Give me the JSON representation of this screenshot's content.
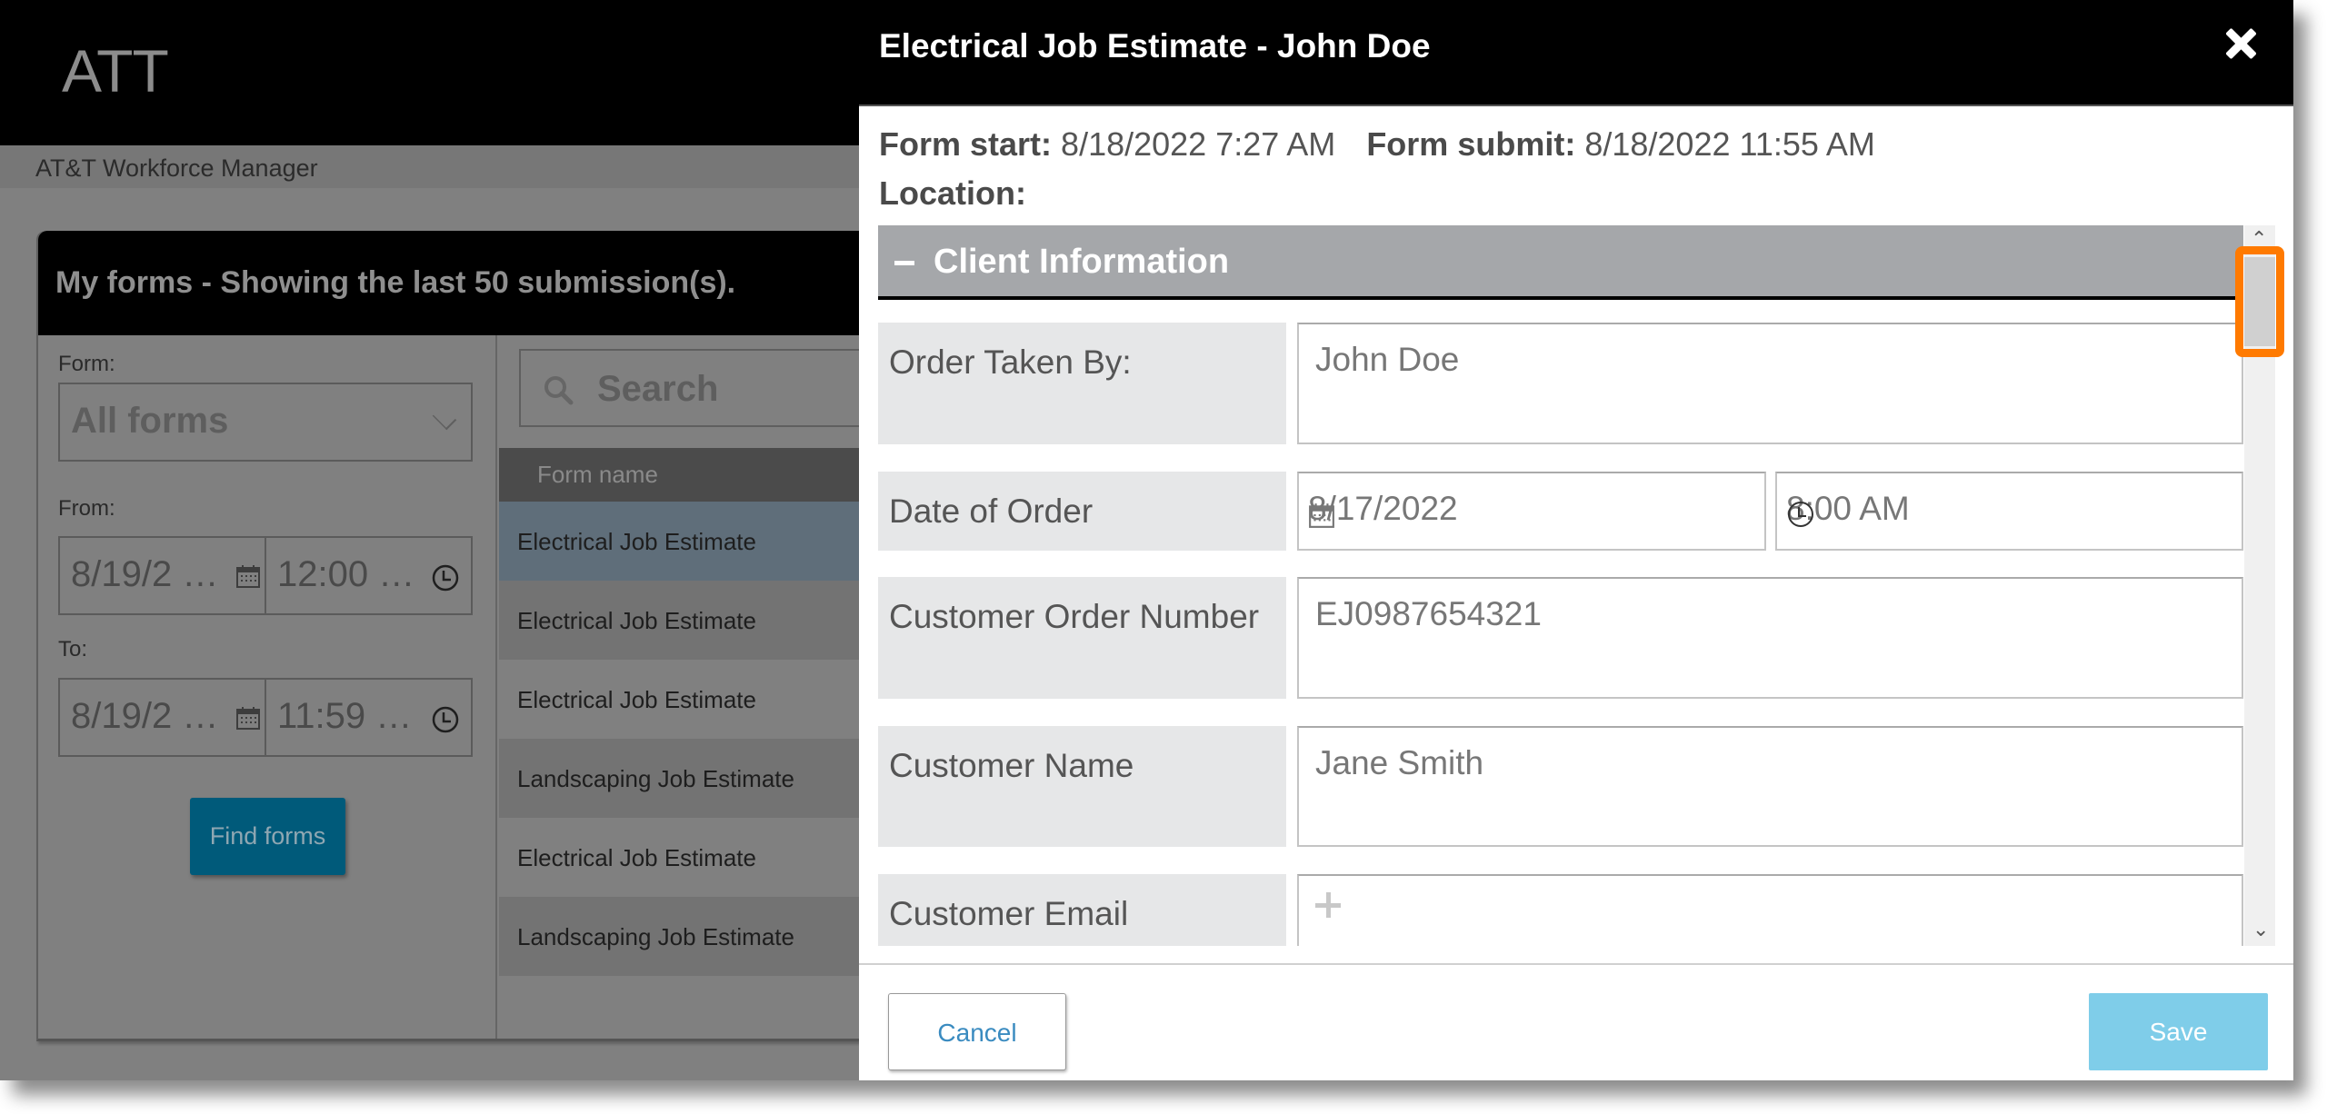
{
  "app": {
    "title": "ATT",
    "breadcrumb": "AT&T Workforce Manager"
  },
  "panel": {
    "title": "My forms - Showing the last 50 submission(s).",
    "filters": {
      "form_label": "Form:",
      "form_value": "All forms",
      "from_label": "From:",
      "from_date": "8/19/2 …",
      "from_time": "12:00 …",
      "to_label": "To:",
      "to_date": "8/19/2 …",
      "to_time": "11:59 …",
      "find_button": "Find forms"
    },
    "results": {
      "search_placeholder": "Search",
      "column_header": "Form name",
      "rows": [
        {
          "name": "Electrical Job Estimate",
          "selected": true
        },
        {
          "name": "Electrical Job Estimate",
          "selected": false
        },
        {
          "name": "Electrical Job Estimate",
          "selected": false
        },
        {
          "name": "Landscaping Job Estimate",
          "selected": false
        },
        {
          "name": "Electrical Job Estimate",
          "selected": false
        },
        {
          "name": "Landscaping Job Estimate",
          "selected": false
        }
      ]
    }
  },
  "modal": {
    "title": "Electrical Job Estimate - John Doe",
    "close_icon": "close-icon",
    "form_start_label": "Form start:",
    "form_start_value": "8/18/2022 7:27 AM",
    "form_submit_label": "Form submit:",
    "form_submit_value": "8/18/2022 11:55 AM",
    "location_label": "Location:",
    "section": {
      "toggle": "−",
      "title": "Client Information",
      "expanded": true
    },
    "fields": [
      {
        "label": "Order Taken By:",
        "value": "John Doe"
      },
      {
        "label": "Date of Order",
        "date": "8/17/2022",
        "time": "8:00 AM"
      },
      {
        "label": "Customer Order Number",
        "value": "EJ0987654321"
      },
      {
        "label": "Customer Name",
        "value": "Jane Smith"
      },
      {
        "label": "Customer Email",
        "value": ""
      }
    ],
    "cancel_button": "Cancel",
    "save_button": "Save"
  },
  "colors": {
    "highlight": "#ff7a00",
    "save_button": "#7fcde9",
    "cancel_text": "#3a8bc0",
    "section_bar": "#a5a7aa"
  }
}
